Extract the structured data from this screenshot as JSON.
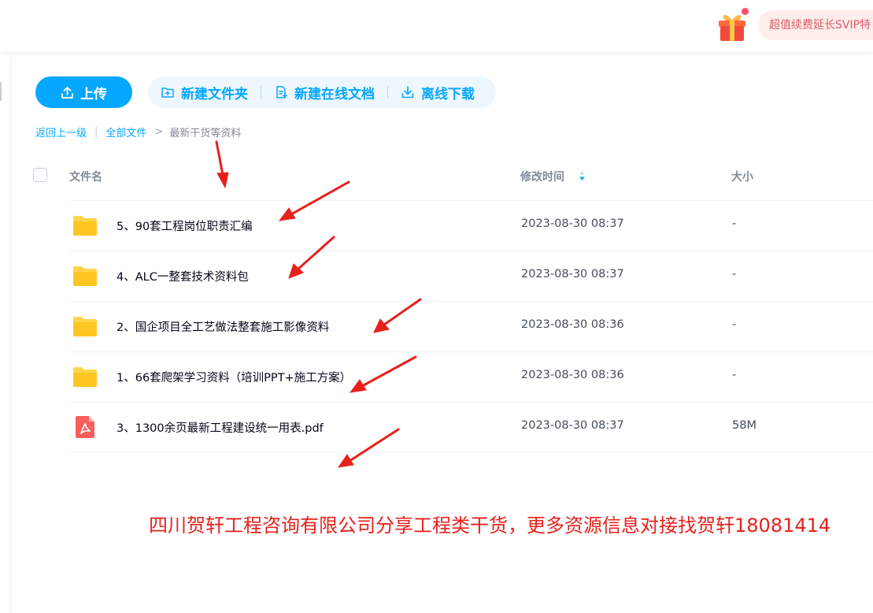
{
  "topbar": {
    "gift_icon": "gift-icon",
    "svip_text": "超值续费延长SVIP特"
  },
  "toolbar": {
    "upload_label": "上传",
    "new_folder_label": "新建文件夹",
    "new_doc_label": "新建在线文档",
    "offline_download_label": "离线下载",
    "accent_color": "#06a7ff"
  },
  "breadcrumb": {
    "back_label": "返回上一级",
    "all_files_label": "全部文件",
    "current_label": "最新干货等资料"
  },
  "table": {
    "headers": {
      "name": "文件名",
      "modified": "修改时间",
      "size": "大小"
    },
    "rows": [
      {
        "icon": "folder-icon",
        "name": "5、90套工程岗位职责汇编",
        "modified": "2023-08-30 08:37",
        "size": "-"
      },
      {
        "icon": "folder-icon",
        "name": "4、ALC一整套技术资料包",
        "modified": "2023-08-30 08:37",
        "size": "-"
      },
      {
        "icon": "folder-icon",
        "name": "2、国企项目全工艺做法整套施工影像资料",
        "modified": "2023-08-30 08:36",
        "size": "-"
      },
      {
        "icon": "folder-icon",
        "name": "1、66套爬架学习资料（培训PPT+施工方案）",
        "modified": "2023-08-30 08:36",
        "size": "-"
      },
      {
        "icon": "pdf-icon",
        "name": "3、1300余页最新工程建设统一用表.pdf",
        "modified": "2023-08-30 08:37",
        "size": "58M"
      }
    ]
  },
  "banner": {
    "text": "四川贺轩工程咨询有限公司分享工程类干货，更多资源信息对接找贺轩18081414",
    "color": "#e8201c"
  }
}
